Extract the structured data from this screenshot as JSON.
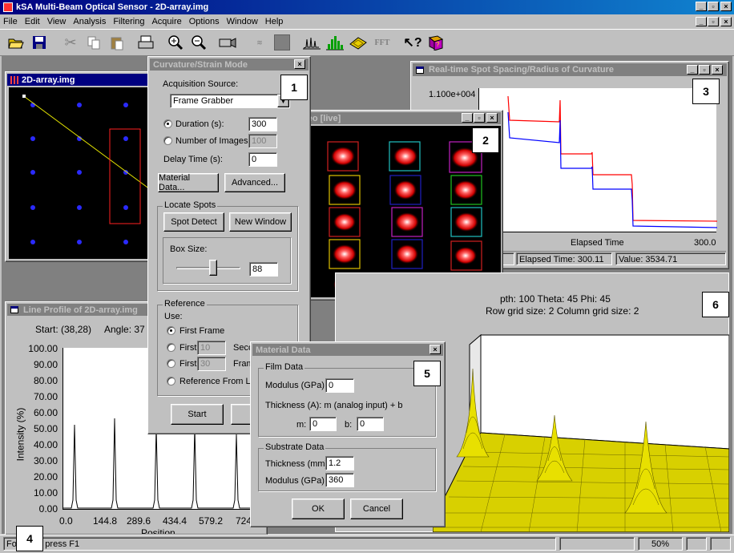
{
  "app": {
    "title": "kSA Multi-Beam Optical Sensor - 2D-array.img",
    "controls": [
      "_",
      "5",
      "x"
    ]
  },
  "menu": [
    "File",
    "Edit",
    "View",
    "Analysis",
    "Filtering",
    "Acquire",
    "Options",
    "Window",
    "Help"
  ],
  "toolbar": {
    "buttons": [
      {
        "name": "open-icon"
      },
      {
        "name": "save-icon"
      },
      {
        "name": "cut-icon"
      },
      {
        "name": "copy-icon"
      },
      {
        "name": "paste-icon"
      },
      {
        "name": "print-icon"
      },
      {
        "name": "zoom-in-icon"
      },
      {
        "name": "zoom-out-icon"
      },
      {
        "name": "camera-icon"
      },
      {
        "name": "filter-icon"
      },
      {
        "name": "stop-icon"
      },
      {
        "name": "line-profile-icon"
      },
      {
        "name": "histogram-icon"
      },
      {
        "name": "3d-view-icon"
      },
      {
        "name": "fft-icon"
      },
      {
        "name": "help-pointer-icon"
      },
      {
        "name": "book-icon"
      }
    ],
    "fft_label": "FFT"
  },
  "image_window": {
    "title": "2D-array.img"
  },
  "curvature_dialog": {
    "title": "Curvature/Strain Mode",
    "acq_source_label": "Acquisition Source:",
    "acq_source_value": "Frame Grabber",
    "duration_label": "Duration (s):",
    "duration_value": "300",
    "num_images_label": "Number of Images:",
    "num_images_value": "100",
    "delay_label": "Delay Time (s):",
    "delay_value": "0",
    "material_data_btn": "Material Data...",
    "advanced_btn": "Advanced...",
    "locate_spots_label": "Locate Spots",
    "spot_detect_btn": "Spot Detect",
    "new_window_btn": "New Window",
    "box_size_label": "Box Size:",
    "box_size_value": "88",
    "reference_label": "Reference",
    "use_label": "Use:",
    "first_frame_label": "First Frame",
    "first_label": "First",
    "first_a_value": "10",
    "first_a_suffix": "Seco",
    "first_b_value": "30",
    "first_b_suffix": "Fram",
    "ref_from_label": "Reference From Las",
    "start_btn": "Start",
    "right_btn_partial": "I"
  },
  "video_window": {
    "title": "deo [live]"
  },
  "realtime_window": {
    "title": "Real-time Spot Spacing/Radius of Curvature",
    "y_top_label": "1.100e+004",
    "x_label": "Elapsed Time",
    "x_max_label": "300.0",
    "status_elapsed": "Elapsed Time: 300.11",
    "status_value": "Value: 3534.71"
  },
  "line_profile_window": {
    "title": "Line Profile of 2D-array.img",
    "start_label": "Start: (38,28)",
    "angle_label": "Angle: 37",
    "y_ticks": [
      "100.00",
      "90.00",
      "80.00",
      "70.00",
      "60.00",
      "50.00",
      "40.00",
      "30.00",
      "20.00",
      "10.00",
      "0.00"
    ],
    "x_ticks": [
      "0.0",
      "144.8",
      "289.6",
      "434.4",
      "579.2",
      "724"
    ],
    "ylabel": "Intensity (%)",
    "xlabel": "Position"
  },
  "view3d_window": {
    "info_line1": "pth: 100     Theta: 45     Phi: 45",
    "info_line2": "Row grid size: 2     Column grid size: 2"
  },
  "material_dialog": {
    "title": "Material Data",
    "film_label": "Film Data",
    "modulus_label": "Modulus (GPa):",
    "modulus_value": "0",
    "thickness_eq": "Thickness (A):  m (analog input) + b",
    "m_label": "m:",
    "m_value": "0",
    "b_label": "b:",
    "b_value": "0",
    "substrate_label": "Substrate Data",
    "sub_thick_label": "Thickness (mm):",
    "sub_thick_value": "1.2",
    "sub_mod_label": "Modulus (GPa):",
    "sub_mod_value": "360",
    "ok_btn": "OK",
    "cancel_btn": "Cancel"
  },
  "statusbar": {
    "help_text": "For Help, press F1",
    "zoom": "50%"
  },
  "callouts": [
    "1",
    "2",
    "3",
    "4",
    "5",
    "6"
  ],
  "colors": {
    "title_active": "#000080",
    "face": "#c0c0c0",
    "series_red": "#ff0000",
    "series_blue": "#0000ff",
    "surface": "#d8d000"
  }
}
